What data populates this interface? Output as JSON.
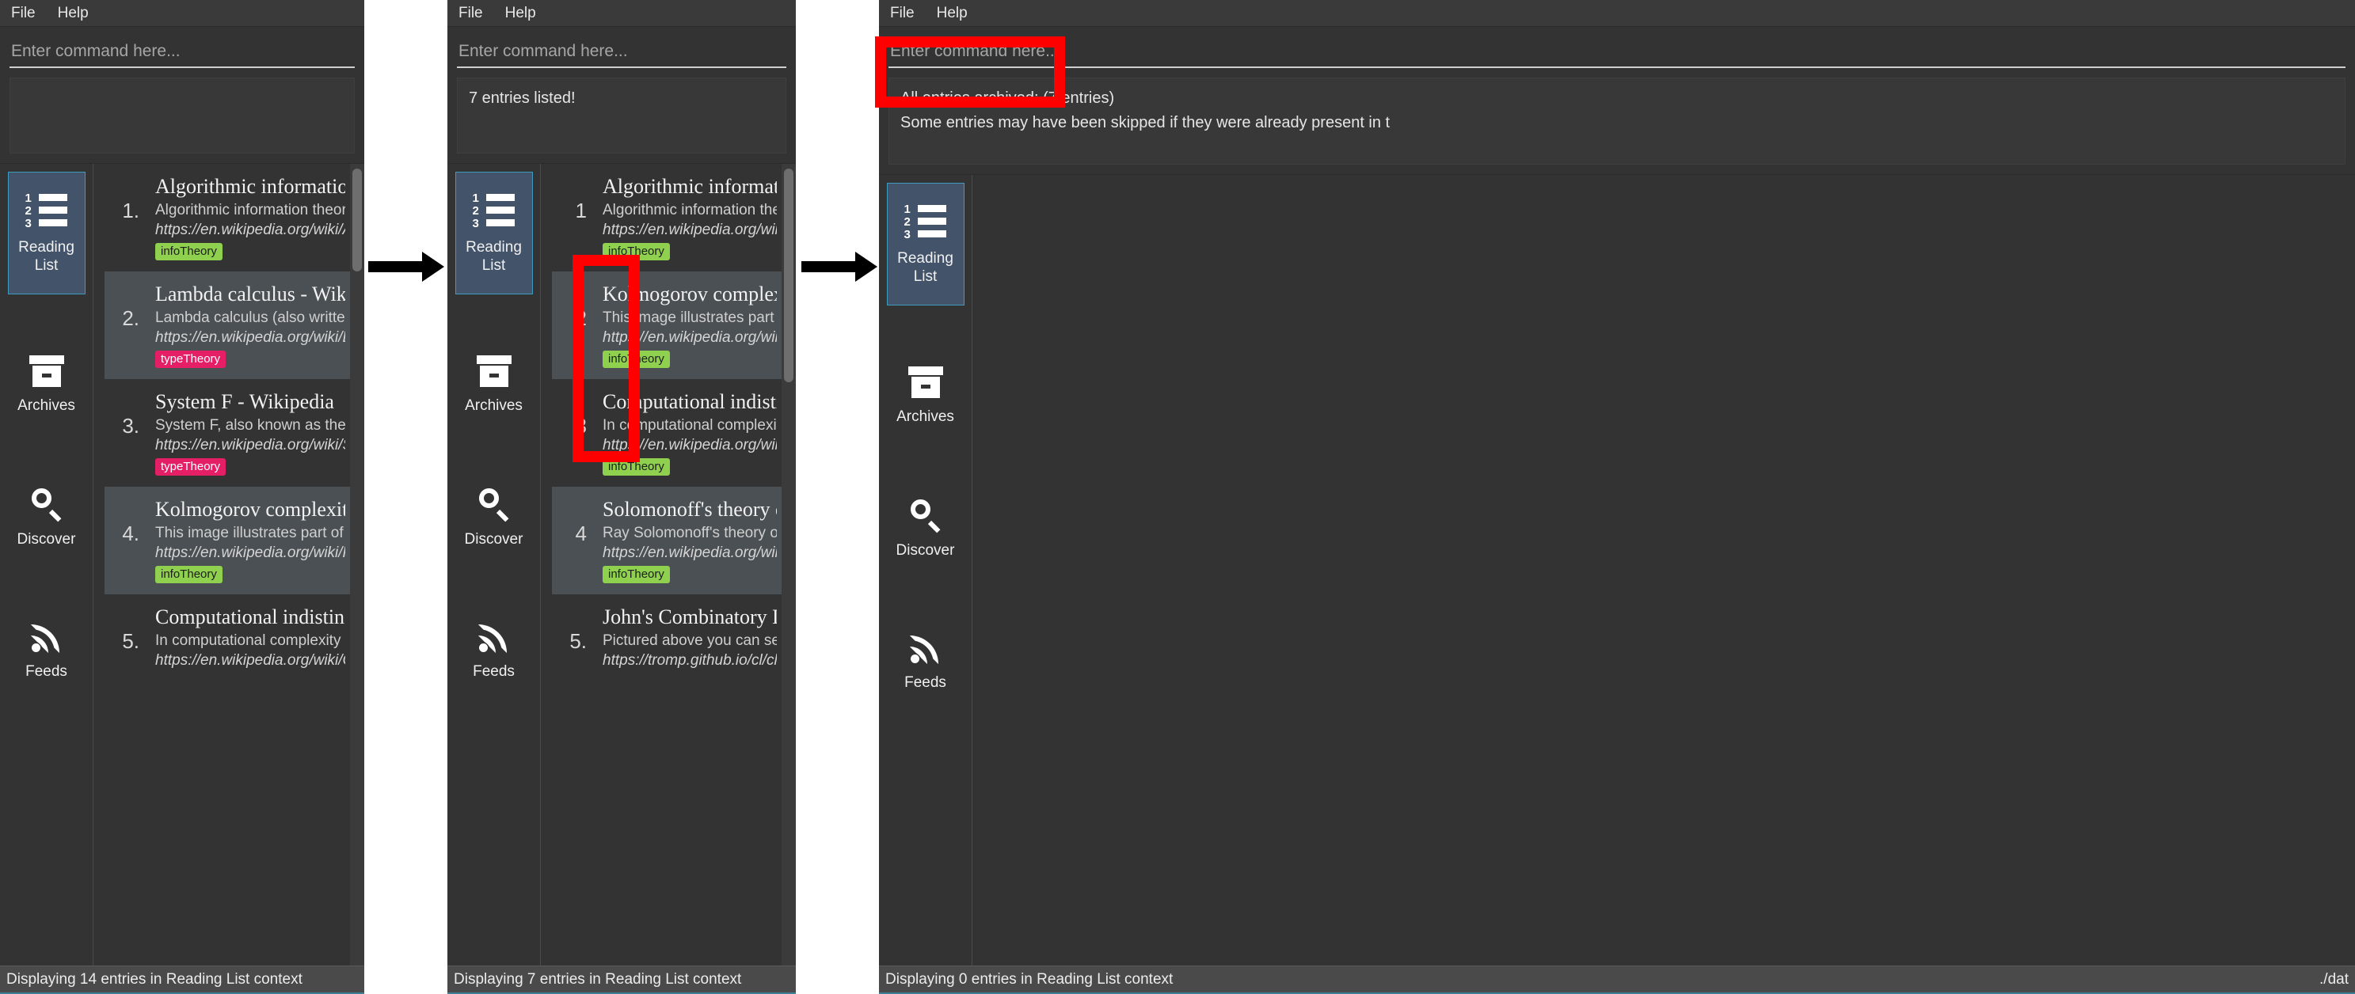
{
  "menu": {
    "file": "File",
    "help": "Help"
  },
  "command_input": {
    "placeholder": "Enter command here...",
    "value": ""
  },
  "sidebar": {
    "items": [
      {
        "label": "Reading\nList",
        "icon": "numbered-list-icon",
        "active": true
      },
      {
        "label": "Archives",
        "icon": "archive-box-icon",
        "active": false
      },
      {
        "label": "Discover",
        "icon": "search-icon",
        "active": false
      },
      {
        "label": "Feeds",
        "icon": "rss-icon",
        "active": false
      }
    ]
  },
  "panel1": {
    "message": "",
    "status_left": "Displaying 14 entries in Reading List context",
    "status_right": "",
    "entries": [
      {
        "num": "1.",
        "title": "Algorithmic information the...",
        "desc": "Algorithmic information theory is a subfi...",
        "url": "https://en.wikipedia.org/wiki/Algorithmic...",
        "tag": "infoTheory",
        "tag_class": "infoTheory"
      },
      {
        "num": "2.",
        "title": "Lambda calculus - Wikipedia",
        "desc": "Lambda calculus (also written as λ-calc...",
        "url": "https://en.wikipedia.org/wiki/Lambda_ca...",
        "tag": "typeTheory",
        "tag_class": "typeTheory"
      },
      {
        "num": "3.",
        "title": "System F - Wikipedia",
        "desc": "System F, also known as the (Girard–Re...",
        "url": "https://en.wikipedia.org/wiki/System_F",
        "tag": "typeTheory",
        "tag_class": "typeTheory"
      },
      {
        "num": "4.",
        "title": "Kolmogorov complexity - Wi...",
        "desc": "This image illustrates part of the",
        "url": "https://en.wikipedia.org/wiki/Kolmogoro...",
        "tag": "infoTheory",
        "tag_class": "infoTheory"
      },
      {
        "num": "5.",
        "title": "Computational indistinguis...",
        "desc": "In computational complexity and crypto...",
        "url": "https://en.wikipedia.org/wiki/Computatio...",
        "tag": "",
        "tag_class": ""
      }
    ]
  },
  "panel2": {
    "message": "7 entries listed!",
    "status_left": "Displaying 7 entries in Reading List context",
    "status_right": "",
    "entries": [
      {
        "num": "1",
        "title": "Algorithmic information the...",
        "desc": "Algorithmic information theory is a subfi...",
        "url": "https://en.wikipedia.org/wiki/Algorithmic...",
        "tag": "infoTheory",
        "tag_class": "infoTheory"
      },
      {
        "num": "2",
        "title": "Kolmogorov complexity - Wi...",
        "desc": "This image illustrates part of the",
        "url": "https://en.wikipedia.org/wiki/Kolmogoro...",
        "tag": "infoTheory",
        "tag_class": "infoTheory"
      },
      {
        "num": "3",
        "title": "Computational indistinguis...",
        "desc": "In computational complexity and crypto...",
        "url": "https://en.wikipedia.org/wiki/Computatio...",
        "tag": "infoTheory",
        "tag_class": "infoTheory"
      },
      {
        "num": "4",
        "title": "Solomonoff's theory of indu...",
        "desc": "Ray Solomonoff's theory of universal ind...",
        "url": "https://en.wikipedia.org/wiki/Solomonoff...",
        "tag": "infoTheory",
        "tag_class": "infoTheory"
      },
      {
        "num": "5.",
        "title": "John's Combinatory Logic Pl...",
        "desc": "Pictured above you can see on the left th...",
        "url": "https://tromp.github.io/cl/cl.html",
        "tag": "",
        "tag_class": ""
      }
    ]
  },
  "panel3": {
    "message_line1": "All entries archived: (7 entries)",
    "message_line2": "Some entries may have been skipped if they were already present in t",
    "status_left": "Displaying 0 entries in Reading List context",
    "status_right": "./dat",
    "entries": []
  },
  "colors": {
    "accent_green": "#8fd14f",
    "accent_pink": "#e51f66",
    "active_nav": "#43536a",
    "active_border": "#3d9cbd",
    "annotation": "#ff0000",
    "window_bg": "#333333",
    "status_bg": "#4a4a4a"
  }
}
